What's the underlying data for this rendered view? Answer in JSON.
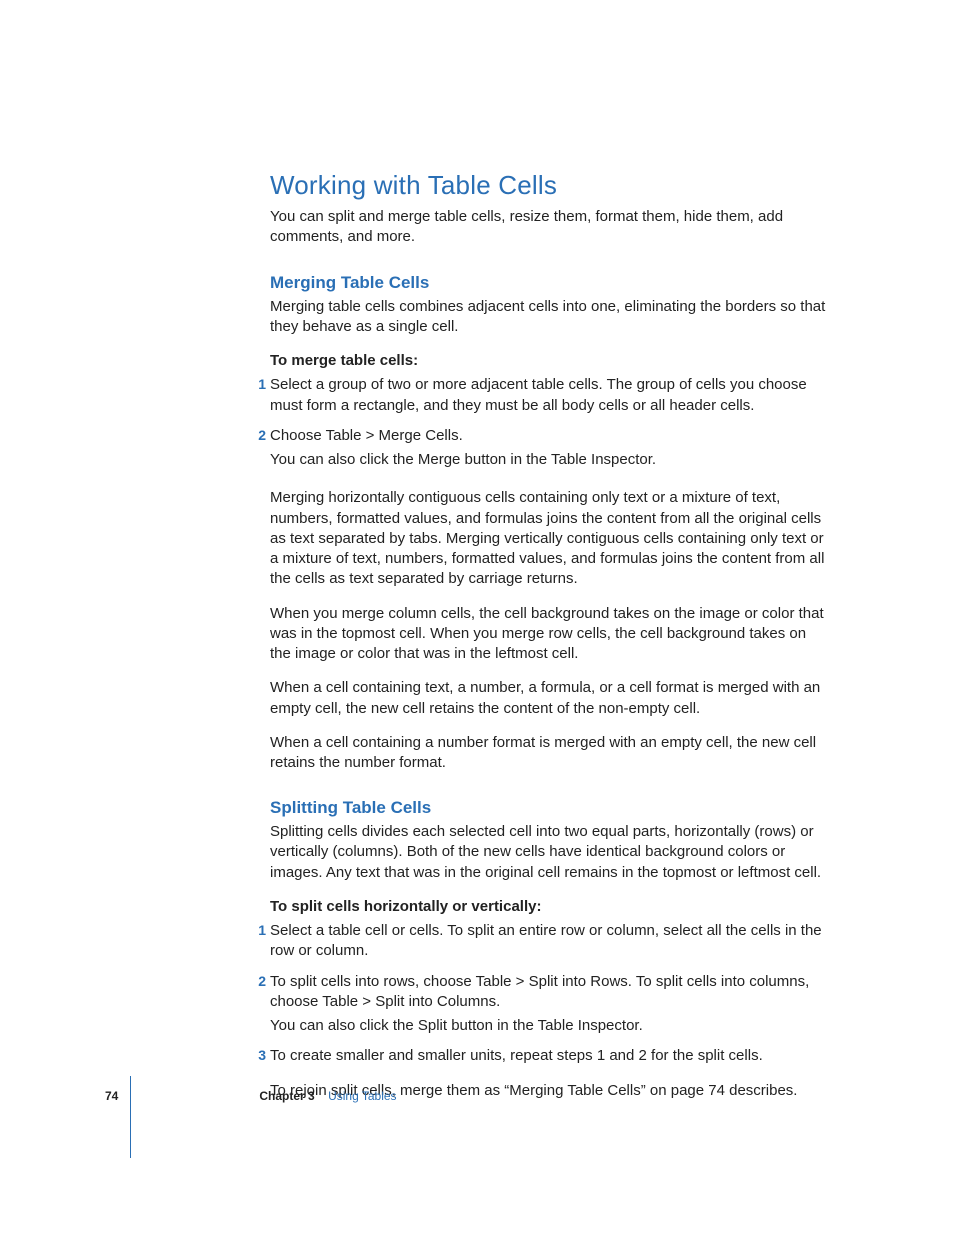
{
  "heading": "Working with Table Cells",
  "intro": "You can split and merge table cells, resize them, format them, hide them, add comments, and more.",
  "section1": {
    "title": "Merging Table Cells",
    "desc": "Merging table cells combines adjacent cells into one, eliminating the borders so that they behave as a single cell.",
    "instrLabel": "To merge table cells:",
    "steps": {
      "s1num": "1",
      "s1": "Select a group of two or more adjacent table cells. The group of cells you choose must form a rectangle, and they must be all body cells or all header cells.",
      "s2num": "2",
      "s2": "Choose Table > Merge Cells.",
      "s2follow": "You can also click the Merge button in the Table Inspector."
    },
    "p1": "Merging horizontally contiguous cells containing only text or a mixture of text, numbers, formatted values, and formulas joins the content from all the original cells as text separated by tabs. Merging vertically contiguous cells containing only text or a mixture of text, numbers, formatted values, and formulas joins the content from all the cells as text separated by carriage returns.",
    "p2": "When you merge column cells, the cell background takes on the image or color that was in the topmost cell. When you merge row cells, the cell background takes on the image or color that was in the leftmost cell.",
    "p3": "When a cell containing text, a number, a formula, or a cell format is merged with an empty cell, the new cell retains the content of the non-empty cell.",
    "p4": "When a cell containing a number format is merged with an empty cell, the new cell retains the number format."
  },
  "section2": {
    "title": "Splitting Table Cells",
    "desc": "Splitting cells divides each selected cell into two equal parts, horizontally (rows) or vertically (columns). Both of the new cells have identical background colors or images. Any text that was in the original cell remains in the topmost or leftmost cell.",
    "instrLabel": "To split cells horizontally or vertically:",
    "steps": {
      "s1num": "1",
      "s1": "Select a table cell or cells. To split an entire row or column, select all the cells in the row or column.",
      "s2num": "2",
      "s2": "To split cells into rows, choose Table > Split into Rows. To split cells into columns, choose Table > Split into Columns.",
      "s2follow": "You can also click the Split button in the Table Inspector.",
      "s3num": "3",
      "s3": "To create smaller and smaller units, repeat steps 1 and 2 for the split cells.",
      "s3follow": "To rejoin split cells, merge them as “Merging Table Cells” on page 74 describes."
    }
  },
  "footer": {
    "page": "74",
    "chapterLabel": "Chapter 3",
    "chapterTitle": "Using Tables"
  }
}
